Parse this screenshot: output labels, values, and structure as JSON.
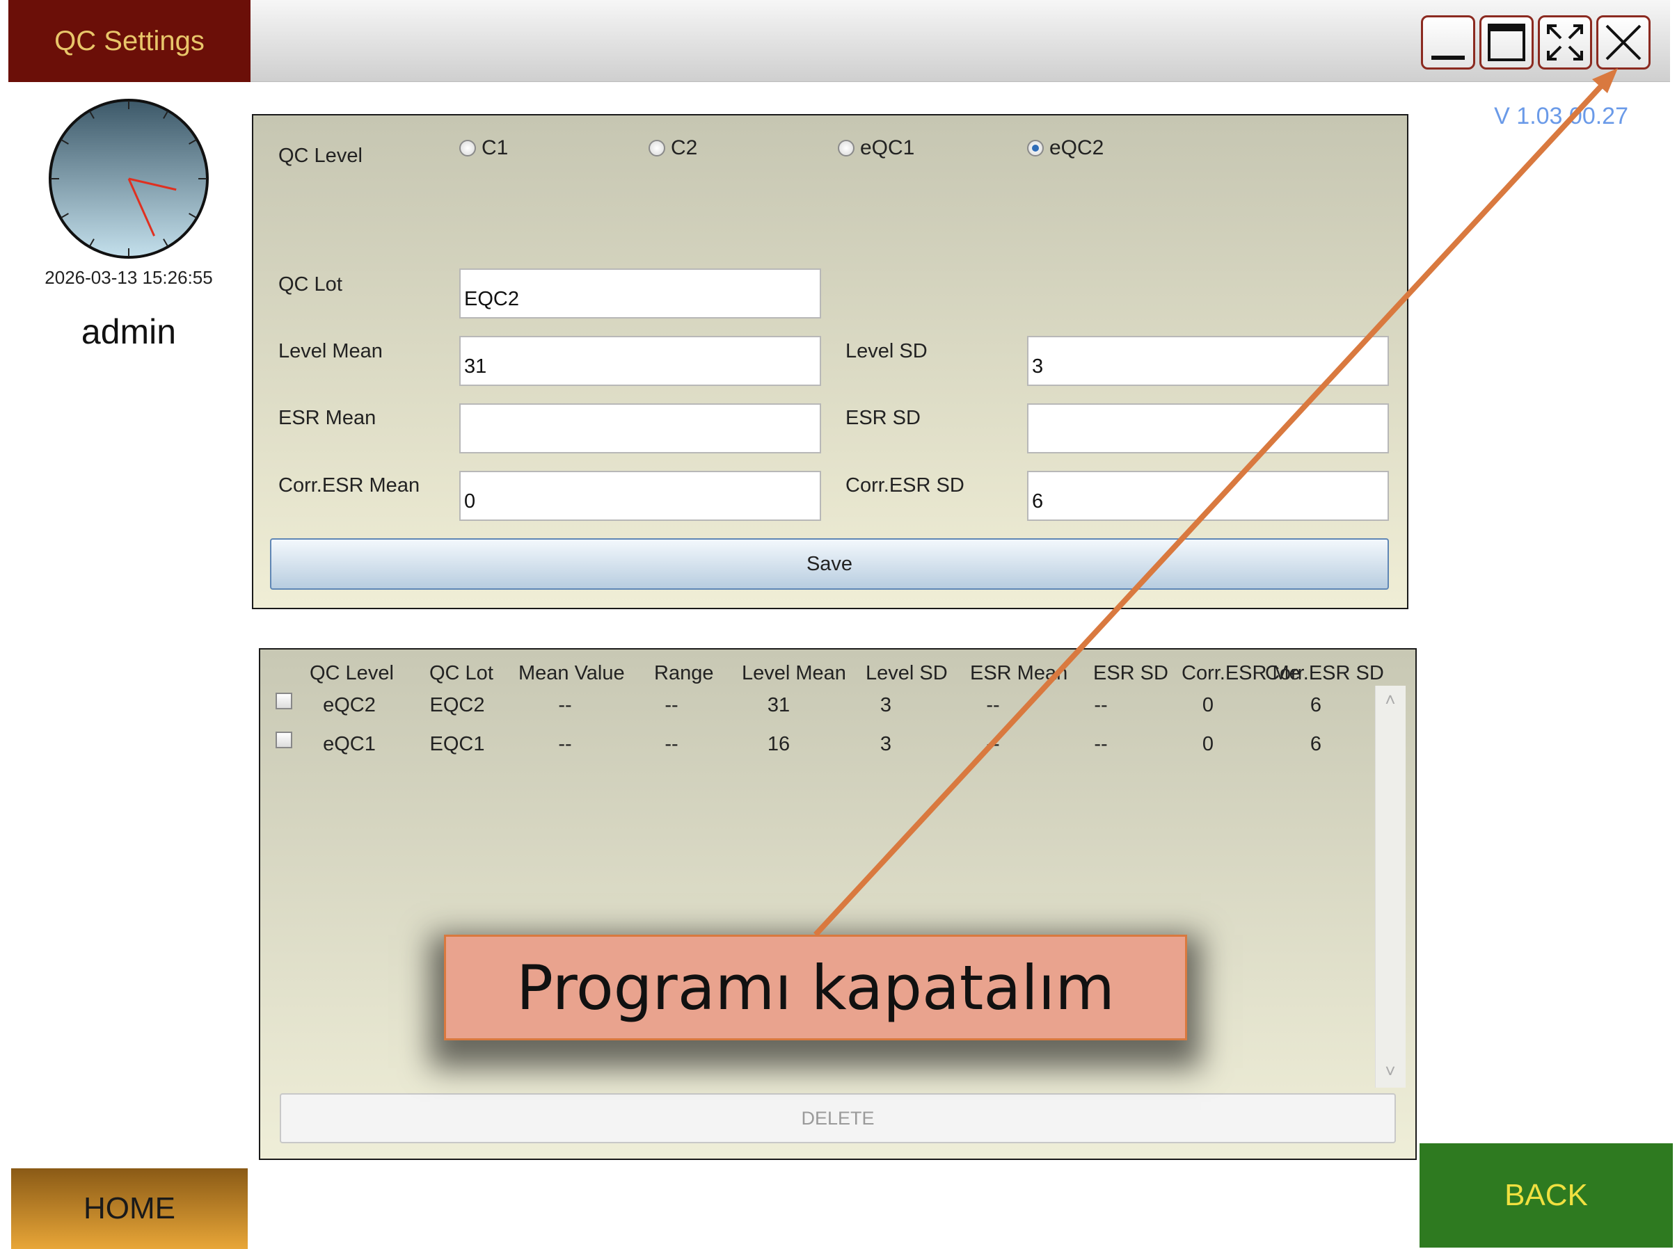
{
  "app": {
    "title": "QC Settings",
    "version": "V 1.03.00.27",
    "datetime": "2026-03-13 15:26:55",
    "user": "admin",
    "clock": {
      "hour": 3,
      "minute": 26,
      "hand_color": "#e03020"
    }
  },
  "window_controls": [
    {
      "name": "minimize-icon"
    },
    {
      "name": "maximize-icon"
    },
    {
      "name": "fullscreen-icon"
    },
    {
      "name": "close-icon"
    }
  ],
  "form": {
    "qc_level_label": "QC Level",
    "levels": [
      {
        "label": "C1",
        "checked": false
      },
      {
        "label": "C2",
        "checked": false
      },
      {
        "label": "eQC1",
        "checked": false
      },
      {
        "label": "eQC2",
        "checked": true
      }
    ],
    "qc_lot_label": "QC Lot",
    "qc_lot_value": "EQC2",
    "level_mean_label": "Level Mean",
    "level_mean_value": "31",
    "level_sd_label": "Level SD",
    "level_sd_value": "3",
    "esr_mean_label": "ESR Mean",
    "esr_mean_value": "",
    "esr_sd_label": "ESR SD",
    "esr_sd_value": "",
    "corr_esr_mean_label": "Corr.ESR Mean",
    "corr_esr_mean_value": "0",
    "corr_esr_sd_label": "Corr.ESR SD",
    "corr_esr_sd_value": "6",
    "save_label": "Save"
  },
  "table": {
    "headers": [
      "QC Level",
      "QC Lot",
      "Mean Value",
      "Range",
      "Level Mean",
      "Level SD",
      "ESR Mean",
      "ESR SD",
      "Corr.ESR Me",
      "Corr.ESR SD"
    ],
    "rows": [
      [
        "eQC2",
        "EQC2",
        "--",
        "--",
        "31",
        "3",
        "--",
        "--",
        "0",
        "6"
      ],
      [
        "eQC1",
        "EQC1",
        "--",
        "--",
        "16",
        "3",
        "--",
        "--",
        "0",
        "6"
      ]
    ],
    "delete_label": "DELETE"
  },
  "nav": {
    "home_label": "HOME",
    "back_label": "BACK"
  },
  "callout": {
    "text": "Programı kapatalım",
    "arrow_color": "#d9793f"
  },
  "colors": {
    "title_bg": "#6b0f08",
    "title_text": "#e8c66a",
    "back_bg": "#2e7a20",
    "home_bg": "#e8a638",
    "version": "#6a9ae8"
  }
}
